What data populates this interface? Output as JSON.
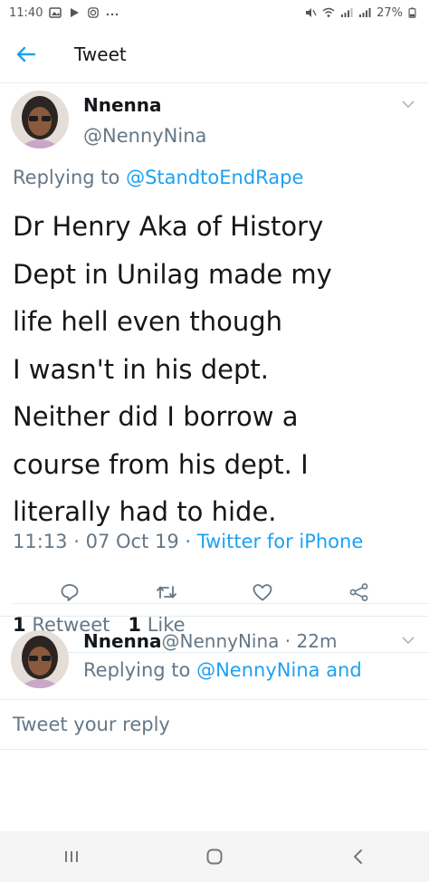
{
  "status_bar": {
    "time": "11:40",
    "battery": "27%",
    "icons": [
      "gallery-icon",
      "play-icon",
      "instagram-icon",
      "more-icon",
      "mute-icon",
      "wifi-icon",
      "signal-icon",
      "signal-icon",
      "battery-icon"
    ]
  },
  "header": {
    "title": "Tweet",
    "back_icon": "back-arrow-icon"
  },
  "tweet": {
    "name": "Nnenna",
    "handle": "@NennyNina",
    "replying_prefix": "Replying to",
    "replying_to": "@StandtoEndRape",
    "text_lines": [
      "Dr Henry Aka of History",
      "Dept in Unilag made my",
      "life hell even though",
      "I wasn't in his dept.",
      "Neither did I borrow a",
      "course from his dept. I",
      "literally had to hide."
    ],
    "time": "11:13",
    "date": "07 Oct 19",
    "source": "Twitter for iPhone",
    "retweets_count": "1",
    "retweets_label": "Retweet",
    "likes_count": "1",
    "likes_label": "Like"
  },
  "actions": [
    "reply-icon",
    "retweet-icon",
    "like-icon",
    "share-icon"
  ],
  "reply": {
    "name": "Nnenna",
    "handle": "@NennyNina",
    "age": "22m",
    "replying_prefix": "Replying to",
    "replying_to": "@NennyNina",
    "replying_suffix": "and"
  },
  "compose": {
    "placeholder": "Tweet your reply"
  },
  "nav": [
    "recent-apps-icon",
    "home-icon",
    "back-icon"
  ],
  "colors": {
    "accent": "#1da1f2",
    "secondary_text": "#657786",
    "text": "#14171a"
  }
}
